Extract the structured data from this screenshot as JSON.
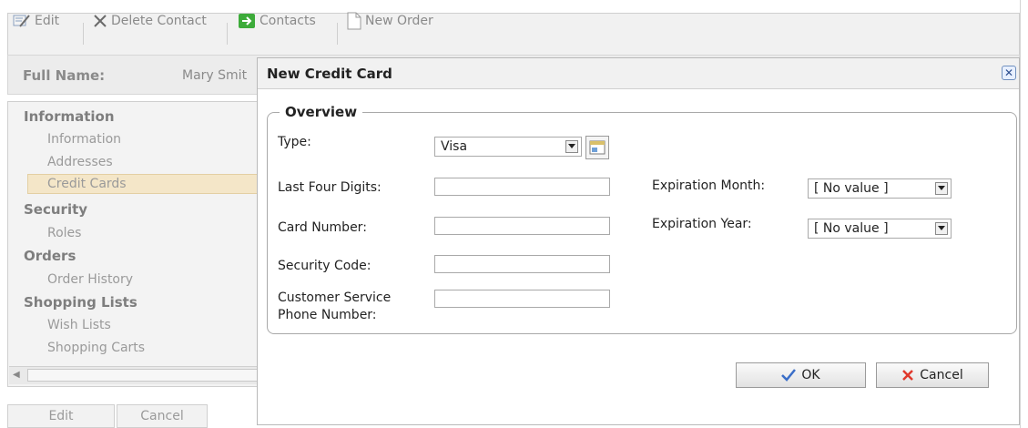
{
  "toolbar": {
    "edit_label": "Edit",
    "delete_label": "Delete Contact",
    "contacts_label": "Contacts",
    "new_order_label": "New Order"
  },
  "contact": {
    "full_name_label": "Full Name:",
    "full_name_value": "Mary Smit"
  },
  "nav": {
    "sections": [
      {
        "title": "Information",
        "items": [
          "Information",
          "Addresses",
          "Credit Cards"
        ]
      },
      {
        "title": "Security",
        "items": [
          "Roles"
        ]
      },
      {
        "title": "Orders",
        "items": [
          "Order History"
        ]
      },
      {
        "title": "Shopping Lists",
        "items": [
          "Wish Lists",
          "Shopping Carts"
        ]
      }
    ],
    "selected": "Credit Cards"
  },
  "bottom_buttons": {
    "edit_label": "Edit",
    "cancel_label": "Cancel"
  },
  "dialog": {
    "title": "New Credit Card",
    "close_glyph": "✕",
    "legend": "Overview",
    "fields": {
      "type_label": "Type:",
      "type_value": "Visa",
      "last_four_label": "Last Four Digits:",
      "last_four_value": "",
      "card_number_label": "Card Number:",
      "card_number_value": "",
      "security_code_label": "Security Code:",
      "security_code_value": "",
      "phone_label_line1": "Customer Service",
      "phone_label_line2": "Phone Number:",
      "phone_value": "",
      "exp_month_label": "Expiration Month:",
      "exp_month_value": "[ No value ]",
      "exp_year_label": "Expiration Year:",
      "exp_year_value": "[ No value ]"
    },
    "ok_label": "OK",
    "cancel_label": "Cancel"
  },
  "colors": {
    "ok_check": "#3a6ec8",
    "cancel_x": "#e0382c",
    "contacts_arrow": "#3dab3a",
    "nav_selected_bg": "#f4e6c8"
  },
  "icons": {
    "edit": "edit-icon",
    "delete": "delete-x-icon",
    "contacts": "green-arrow-icon",
    "new_order": "document-icon",
    "type_lookup": "card-lookup-icon",
    "ok": "checkmark-icon",
    "cancel": "red-x-icon",
    "close": "close-icon"
  }
}
